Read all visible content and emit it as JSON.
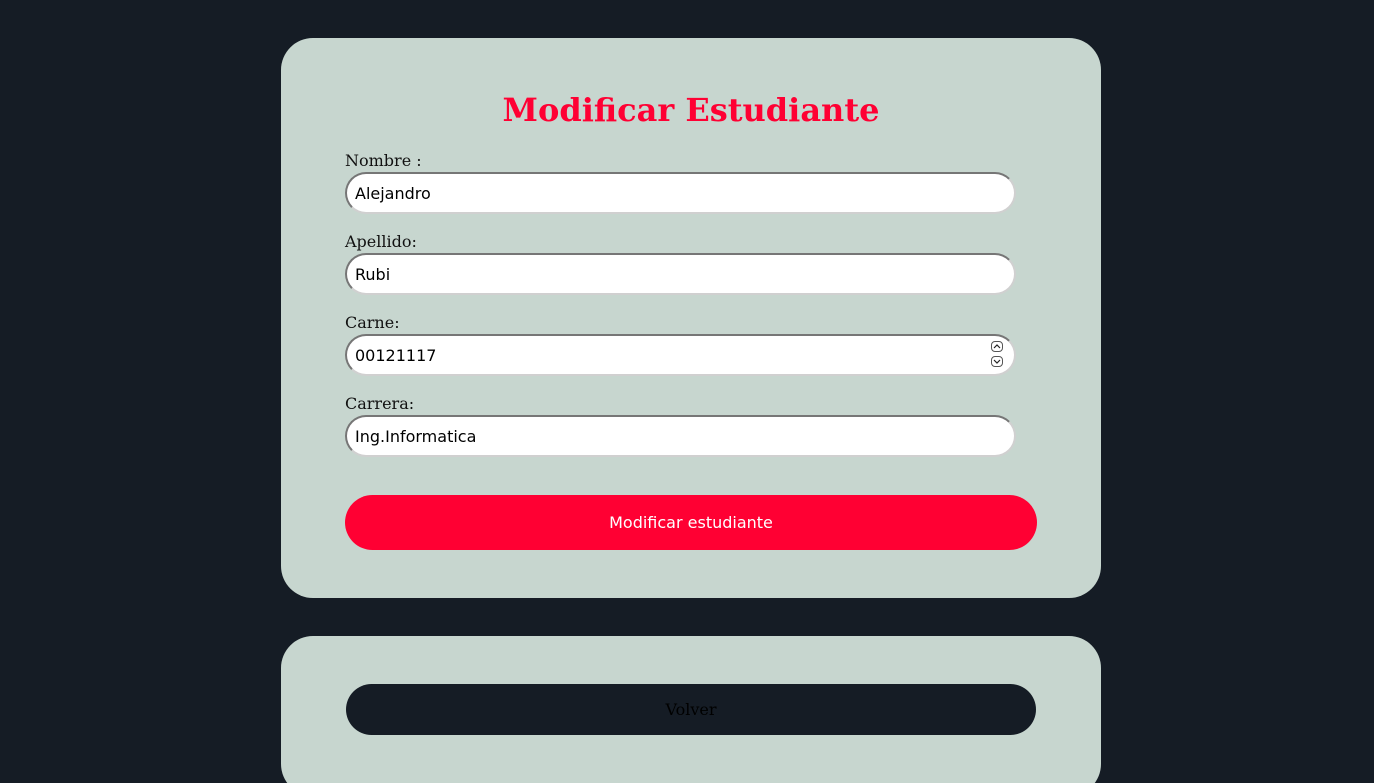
{
  "form": {
    "title": "Modificar Estudiante",
    "fields": [
      {
        "label": "Nombre :",
        "value": "Alejandro",
        "type": "text"
      },
      {
        "label": "Apellido:",
        "value": "Rubi",
        "type": "text"
      },
      {
        "label": "Carne:",
        "value": "00121117",
        "type": "number"
      },
      {
        "label": "Carrera:",
        "value": "Ing.Informatica",
        "type": "text"
      }
    ],
    "submit_label": "Modificar estudiante"
  },
  "back": {
    "label": "Volver"
  },
  "colors": {
    "background": "#151c25",
    "card": "#c7d6cf",
    "accent": "#ff0033",
    "back_button": "#151c25"
  }
}
